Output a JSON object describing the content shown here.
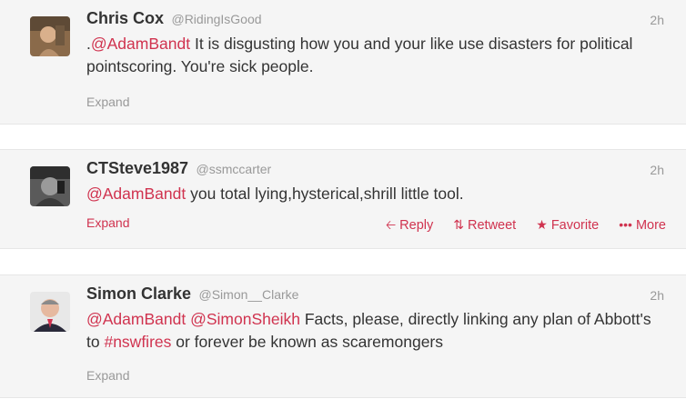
{
  "tweets": [
    {
      "fullname": "Chris Cox",
      "username": "@RidingIsGood",
      "time": "2h",
      "text": {
        "prefix": ".",
        "mention": "@AdamBandt",
        "body": " It is disgusting how you and your like use disasters for political pointscoring. You're sick people."
      },
      "expand": "Expand"
    },
    {
      "fullname": "CTSteve1987",
      "username": "@ssmccarter",
      "time": "2h",
      "text": {
        "mention": "@AdamBandt",
        "body": " you total lying,hysterical,shrill little tool."
      },
      "expand": "Expand",
      "actions": {
        "reply": "Reply",
        "retweet": "Retweet",
        "favorite": "Favorite",
        "more": "More"
      }
    },
    {
      "fullname": "Simon Clarke",
      "username": "@Simon__Clarke",
      "time": "2h",
      "text": {
        "mention1": "@AdamBandt",
        "mention2": "@SimonSheikh",
        "body1": " Facts, please, directly linking any plan of Abbott's to ",
        "hashtag": "#nswfires",
        "body2": " or forever be known as scaremongers"
      },
      "expand": "Expand"
    }
  ],
  "icons": {
    "reply": "reply-arrow-icon",
    "retweet": "retweet-icon",
    "favorite": "star-icon",
    "more": "more-dots-icon"
  },
  "colors": {
    "link": "#d0334f",
    "card_bg": "#f5f5f5",
    "muted": "#999999",
    "text": "#333333"
  }
}
